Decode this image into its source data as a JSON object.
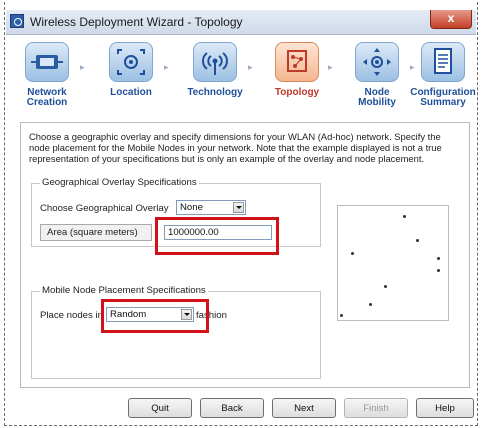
{
  "window": {
    "title": "Wireless Deployment Wizard - Topology",
    "close_label": "x"
  },
  "steps": [
    {
      "label_line1": "Network",
      "label_line2": "Creation",
      "icon": "network-card-icon",
      "active": false
    },
    {
      "label_line1": "Location",
      "label_line2": "",
      "icon": "location-crosshair-icon",
      "active": false
    },
    {
      "label_line1": "Technology",
      "label_line2": "",
      "icon": "antenna-icon",
      "active": false
    },
    {
      "label_line1": "Topology",
      "label_line2": "",
      "icon": "topology-icon",
      "active": true
    },
    {
      "label_line1": "Node",
      "label_line2": "Mobility",
      "icon": "node-mobility-icon",
      "active": false
    },
    {
      "label_line1": "Configuration",
      "label_line2": "Summary",
      "icon": "document-icon",
      "active": false
    }
  ],
  "description": "Choose a geographic overlay and specify dimensions for your WLAN (Ad-hoc) network. Specify the node placement for the Mobile Nodes in your network. Note that the example displayed is not a true representation of your specifications but is only an example of the overlay and node placement.",
  "geo": {
    "group_title": "Geographical Overlay Specifications",
    "overlay_label": "Choose Geographical Overlay",
    "overlay_value": "None",
    "area_label": "Area (square meters)",
    "area_value": "1000000.00"
  },
  "placement": {
    "group_title": "Mobile Node Placement Specifications",
    "label_prefix": "Place nodes in",
    "label_suffix": "fashion",
    "value": "Random"
  },
  "buttons": {
    "quit": "Quit",
    "back": "Back",
    "next": "Next",
    "finish": "Finish",
    "help": "Help"
  },
  "colors": {
    "highlight": "#d2121b",
    "active_step": "#c0392b",
    "step_label": "#1f4f9a"
  }
}
